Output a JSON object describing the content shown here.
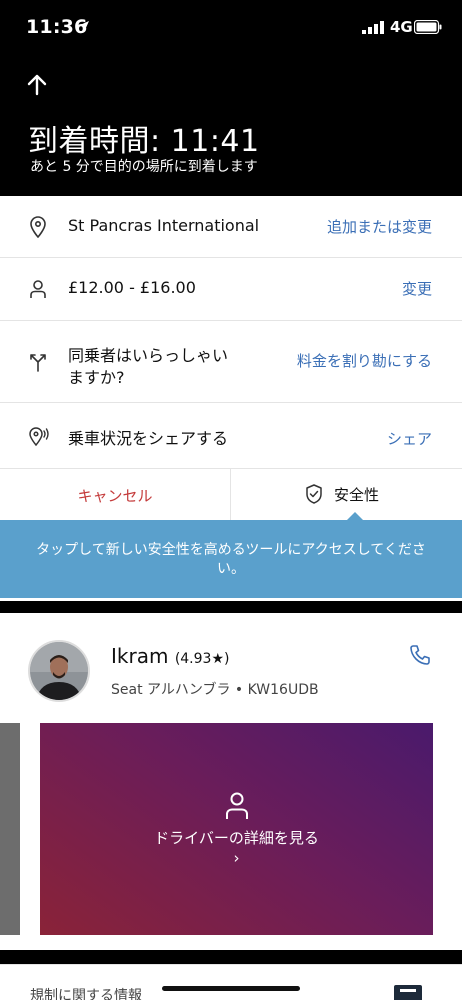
{
  "status_bar": {
    "time": "11:36",
    "network": "4G"
  },
  "header": {
    "title": "到着時間: 11:41",
    "subtitle": "あと 5 分で目的の場所に到着します"
  },
  "rows": {
    "destination": {
      "label": "St Pancras International",
      "action": "追加または変更"
    },
    "fare": {
      "label": "£12.00 - £16.00",
      "action": "変更"
    },
    "split": {
      "label_line1": "同乗者はいらっしゃい",
      "label_line2": "ますか?",
      "action": "料金を割り勘にする"
    },
    "share": {
      "label": "乗車状況をシェアする",
      "action": "シェア"
    }
  },
  "actions": {
    "cancel": "キャンセル",
    "safety": "安全性"
  },
  "tooltip": {
    "text": "タップして新しい安全性を高めるツールにアクセスしてください。"
  },
  "driver": {
    "name": "Ikram",
    "rating": "(4.93★)",
    "car": "Seat アルハンブラ • KW16UDB"
  },
  "promo": {
    "text": "ドライバーの詳細を見る",
    "chevron": "›"
  },
  "regulatory": {
    "label": "規制に関する情報"
  },
  "colors": {
    "link": "#3b6fb6",
    "cancel": "#c43a3a",
    "tooltip": "#5aa0cc"
  }
}
